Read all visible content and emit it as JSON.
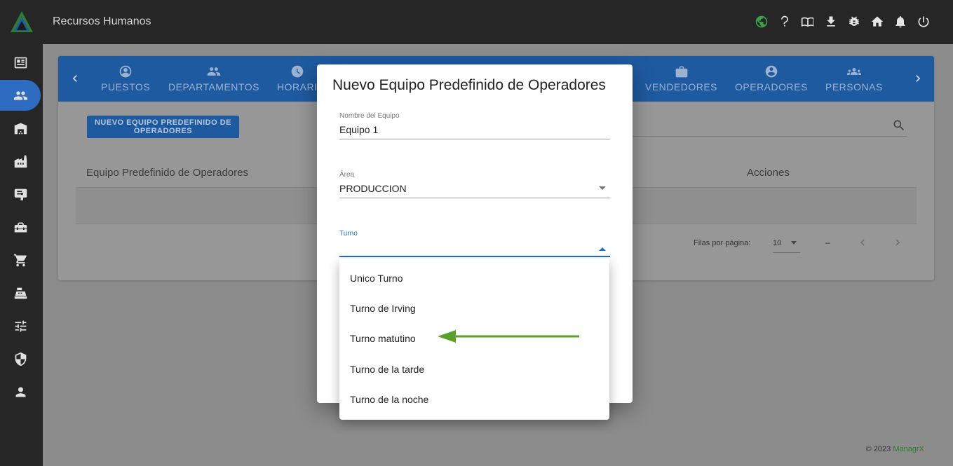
{
  "app": {
    "title": "Recursos Humanos"
  },
  "topbar_icons": [
    "globe-icon",
    "help-icon",
    "book-icon",
    "download-icon",
    "bug-icon",
    "home-icon",
    "bell-icon",
    "power-icon"
  ],
  "sidebar_icons": [
    "news-icon",
    "people-icon",
    "warehouse-icon",
    "factory-icon",
    "certificate-icon",
    "toolbox-icon",
    "cart-icon",
    "register-icon",
    "sliders-icon",
    "shield-icon",
    "person-icon"
  ],
  "tabs": [
    {
      "label": "PUESTOS",
      "icon": "account-circle-icon"
    },
    {
      "label": "DEPARTAMENTOS",
      "icon": "people-icon"
    },
    {
      "label": "HORARI",
      "icon": "clock-icon"
    },
    {
      "label": "VENDEDORES",
      "icon": "briefcase-icon"
    },
    {
      "label": "OPERADORES",
      "icon": "account-circle-icon"
    },
    {
      "label": "PERSONAS",
      "icon": "groups-icon"
    }
  ],
  "main": {
    "new_button": "NUEVO EQUIPO PREDEFINIDO DE OPERADORES",
    "columns": [
      "Equipo Predefinido de Operadores",
      "Acciones"
    ],
    "pager": {
      "rows_label": "Filas por página:",
      "rows_value": "10",
      "range": "–"
    }
  },
  "modal": {
    "title": "Nuevo Equipo Predefinido de Operadores",
    "fields": {
      "name": {
        "label": "Nombre del Equipo",
        "value": "Equipo 1"
      },
      "area": {
        "label": "Área",
        "value": "PRODUCCION"
      },
      "shift": {
        "label": "Turno",
        "value": ""
      }
    }
  },
  "dropdown": {
    "options": [
      "Unico Turno",
      "Turno de Irving",
      "Turno matutino",
      "Turno de la tarde",
      "Turno de la noche"
    ]
  },
  "footer": {
    "copyright": "© 2023",
    "brand": "ManagrX"
  },
  "colors": {
    "primary": "#1e6fc8",
    "topbar": "#262626",
    "arrow": "#5aa02c",
    "brand": "#2e7d32"
  }
}
